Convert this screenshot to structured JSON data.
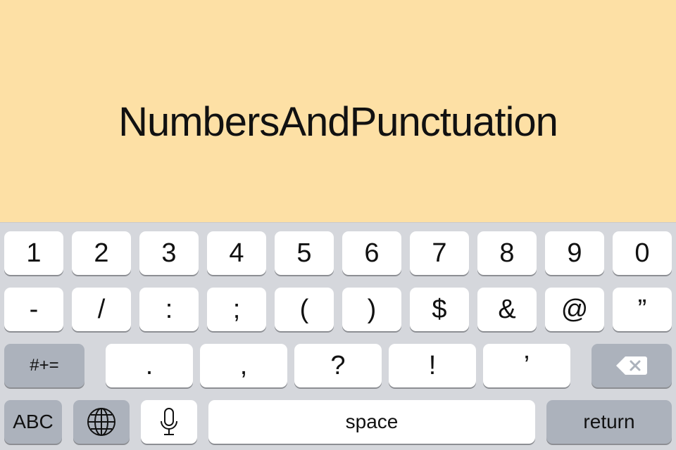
{
  "display": {
    "title": "NumbersAndPunctuation"
  },
  "keyboard": {
    "row1": [
      "1",
      "2",
      "3",
      "4",
      "5",
      "6",
      "7",
      "8",
      "9",
      "0"
    ],
    "row2": [
      "-",
      "/",
      ":",
      ";",
      "(",
      ")",
      "$",
      "&",
      "@",
      "”"
    ],
    "row3": {
      "shift_label": "#+=",
      "keys": [
        ".",
        ",",
        "?",
        "!",
        "’"
      ],
      "delete_icon": "backspace-icon"
    },
    "row4": {
      "abc_label": "ABC",
      "globe_icon": "globe-icon",
      "mic_icon": "microphone-icon",
      "space_label": "space",
      "return_label": "return"
    }
  },
  "colors": {
    "top_background": "#fde0a5",
    "keyboard_background": "#d5d7dc",
    "key_background": "#ffffff",
    "function_key_background": "#acb2bc"
  }
}
